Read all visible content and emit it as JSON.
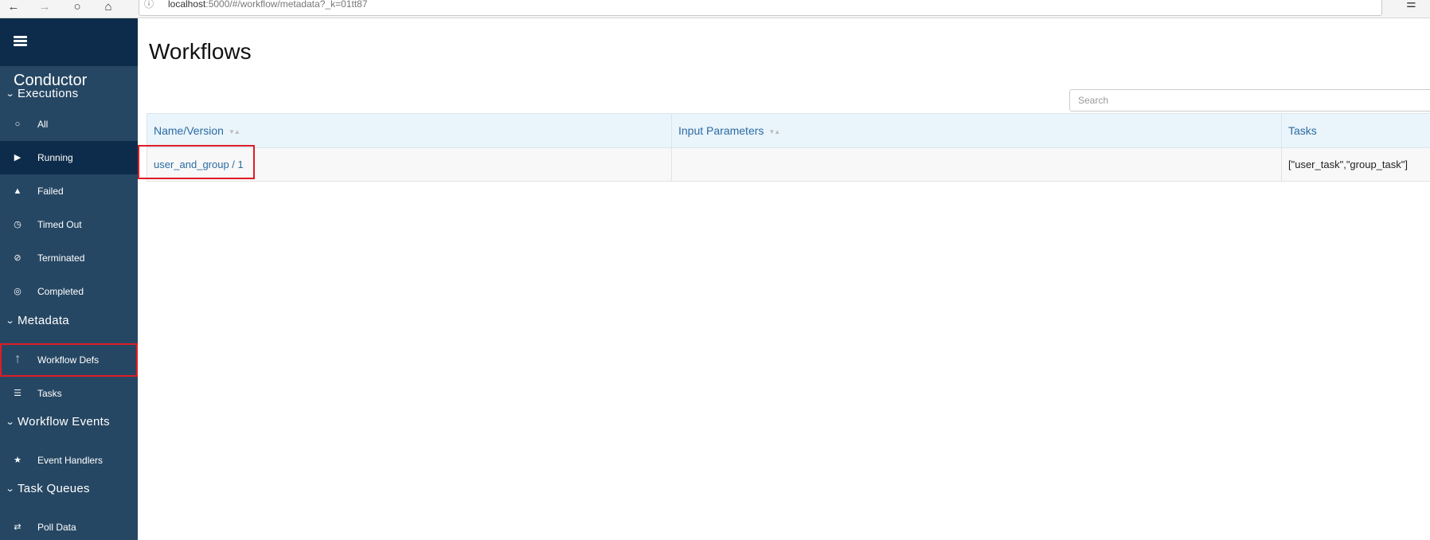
{
  "browser": {
    "url_host": "localhost",
    "url_rest": ":5000/#/workflow/metadata?_k=01tt87"
  },
  "sidebar": {
    "title": "Conductor",
    "sections": [
      {
        "label": "Executions",
        "items": [
          {
            "label": "All",
            "icon": "circle-outline-icon"
          },
          {
            "label": "Running",
            "icon": "play-circle-icon"
          },
          {
            "label": "Failed",
            "icon": "warning-icon"
          },
          {
            "label": "Timed Out",
            "icon": "clock-icon"
          },
          {
            "label": "Terminated",
            "icon": "ban-icon"
          },
          {
            "label": "Completed",
            "icon": "bullseye-icon"
          }
        ]
      },
      {
        "label": "Metadata",
        "items": [
          {
            "label": "Workflow Defs",
            "icon": "code-fork-icon"
          },
          {
            "label": "Tasks",
            "icon": "tasks-icon"
          }
        ]
      },
      {
        "label": "Workflow Events",
        "items": [
          {
            "label": "Event Handlers",
            "icon": "star-icon"
          }
        ]
      },
      {
        "label": "Task Queues",
        "items": [
          {
            "label": "Poll Data",
            "icon": "exchange-icon"
          }
        ]
      }
    ],
    "active_item": "Running",
    "highlighted_item": "Workflow Defs"
  },
  "main": {
    "title": "Workflows",
    "search": {
      "placeholder": "Search",
      "value": ""
    },
    "table": {
      "columns": [
        "Name/Version",
        "Input Parameters",
        "Tasks"
      ],
      "rows": [
        {
          "name_version": "user_and_group / 1",
          "input_parameters": "",
          "tasks": "[\"user_task\",\"group_task\"]"
        }
      ]
    }
  },
  "colors": {
    "sidebar_bg": "#264763",
    "sidebar_header_bg": "#0d2c4b",
    "link": "#2a6ba3",
    "table_header_bg": "#eaf4fb",
    "highlight_border": "#e01b24"
  }
}
